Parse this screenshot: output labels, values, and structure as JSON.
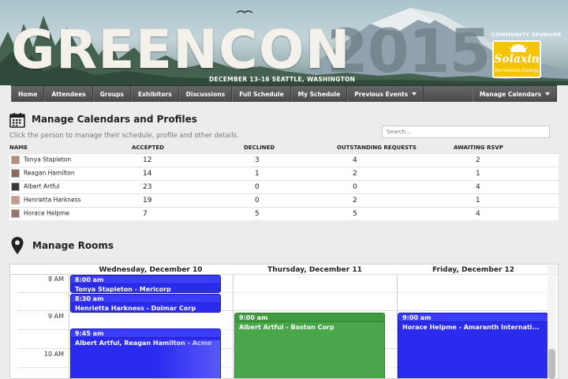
{
  "banner": {
    "title": "GREENCON",
    "year": "2015",
    "dates": "DECEMBER 13-16   SEATTLE, WASHINGTON",
    "sponsor_label": "COMMUNITY SPONSOR",
    "sponsor_name": "Solaxin",
    "sponsor_tagline": "Renewable Energy",
    "sponsor_color": "#f5c400"
  },
  "nav": {
    "items": [
      "Home",
      "Attendees",
      "Groups",
      "Exhibitors",
      "Discussions",
      "Full Schedule",
      "My Schedule"
    ],
    "previous_events": "Previous Events",
    "manage_calendars": "Manage Calendars"
  },
  "profiles": {
    "title": "Manage Calendars and Profiles",
    "subtitle": "Click the person to manage their schedule, profile and other details.",
    "search_placeholder": "Search...",
    "columns": [
      "NAME",
      "ACCEPTED",
      "DECLINED",
      "OUTSTANDING REQUESTS",
      "AWAITING RSVP"
    ],
    "rows": [
      {
        "name": "Tonya Stapleton",
        "accepted": "12",
        "declined": "3",
        "outstanding": "4",
        "awaiting": "2",
        "avatar_color": "#b88d73"
      },
      {
        "name": "Reagan Hamilton",
        "accepted": "14",
        "declined": "1",
        "outstanding": "2",
        "awaiting": "1",
        "avatar_color": "#8a6a58"
      },
      {
        "name": "Albert Artful",
        "accepted": "23",
        "declined": "0",
        "outstanding": "0",
        "awaiting": "4",
        "avatar_color": "#3a3a3a"
      },
      {
        "name": "Henrietta Harkness",
        "accepted": "19",
        "declined": "0",
        "outstanding": "2",
        "awaiting": "1",
        "avatar_color": "#c79a86"
      },
      {
        "name": "Horace Helpme",
        "accepted": "7",
        "declined": "5",
        "outstanding": "5",
        "awaiting": "4",
        "avatar_color": "#9d7766"
      }
    ]
  },
  "rooms": {
    "title": "Manage Rooms",
    "days": [
      "Wednesday, December 10",
      "Thursday, December 11",
      "Friday, December 12"
    ],
    "times": [
      "8 AM",
      "9 AM",
      "10 AM"
    ],
    "events": [
      {
        "time": "8:00 am",
        "label": "Tonya Stapleton - Mericorp",
        "color": "#2b2bf0"
      },
      {
        "time": "8:30 am",
        "label": "Henrietta Harkness - Dolmar Corp",
        "color": "#2b2bf0"
      },
      {
        "time": "9:45 am",
        "label": "Albert Artful, Reagan Hamilton - Acme",
        "color": "#2b2bf0"
      },
      {
        "time": "9:00 am",
        "label": "Albert Artful - Boston Corp",
        "color": "#4aa64a"
      },
      {
        "time": "9:00 am",
        "label": "Horace Helpme - Amaranth Internati...",
        "color": "#2b2bf0"
      }
    ]
  }
}
